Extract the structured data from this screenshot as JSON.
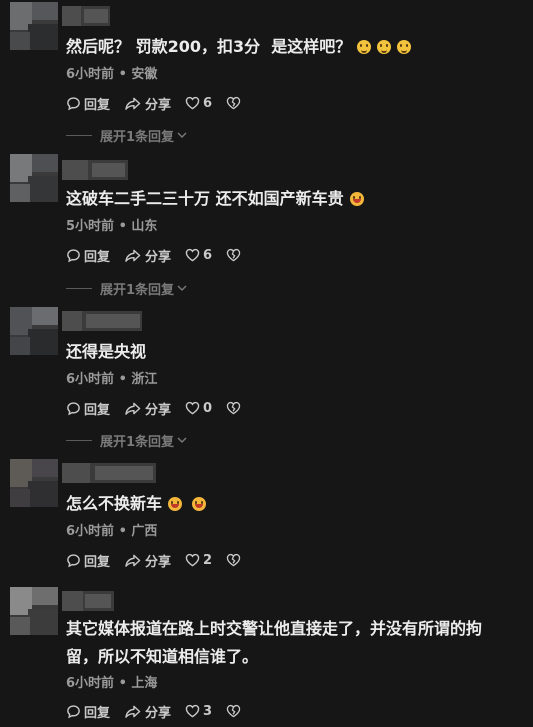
{
  "labels": {
    "reply": "回复",
    "share": "分享",
    "expand": "展开1条回复"
  },
  "comments": [
    {
      "text": "然后呢？ 罚款200，扣3分  是这样吧？",
      "emojis": [
        "smile",
        "smile",
        "smile"
      ],
      "meta": "6小时前 • 安徽",
      "likes": "6",
      "has_replies": true
    },
    {
      "text": "这破车二手二三十万 还不如国产新车贵",
      "emojis": [
        "laugh"
      ],
      "meta": "5小时前 • 山东",
      "likes": "6",
      "has_replies": true
    },
    {
      "text": "还得是央视",
      "emojis": [],
      "meta": "6小时前 • 浙江",
      "likes": "0",
      "has_replies": true
    },
    {
      "text": "怎么不换新车",
      "emojis": [
        "laugh",
        "laugh"
      ],
      "meta": "6小时前 • 广西",
      "likes": "2",
      "has_replies": false
    },
    {
      "text": "其它媒体报道在路上时交警让他直接走了，并没有所谓的拘留，所以不知道相信谁了。",
      "emojis": [],
      "meta": "6小时前 • 上海",
      "likes": "3",
      "has_replies": false
    }
  ]
}
